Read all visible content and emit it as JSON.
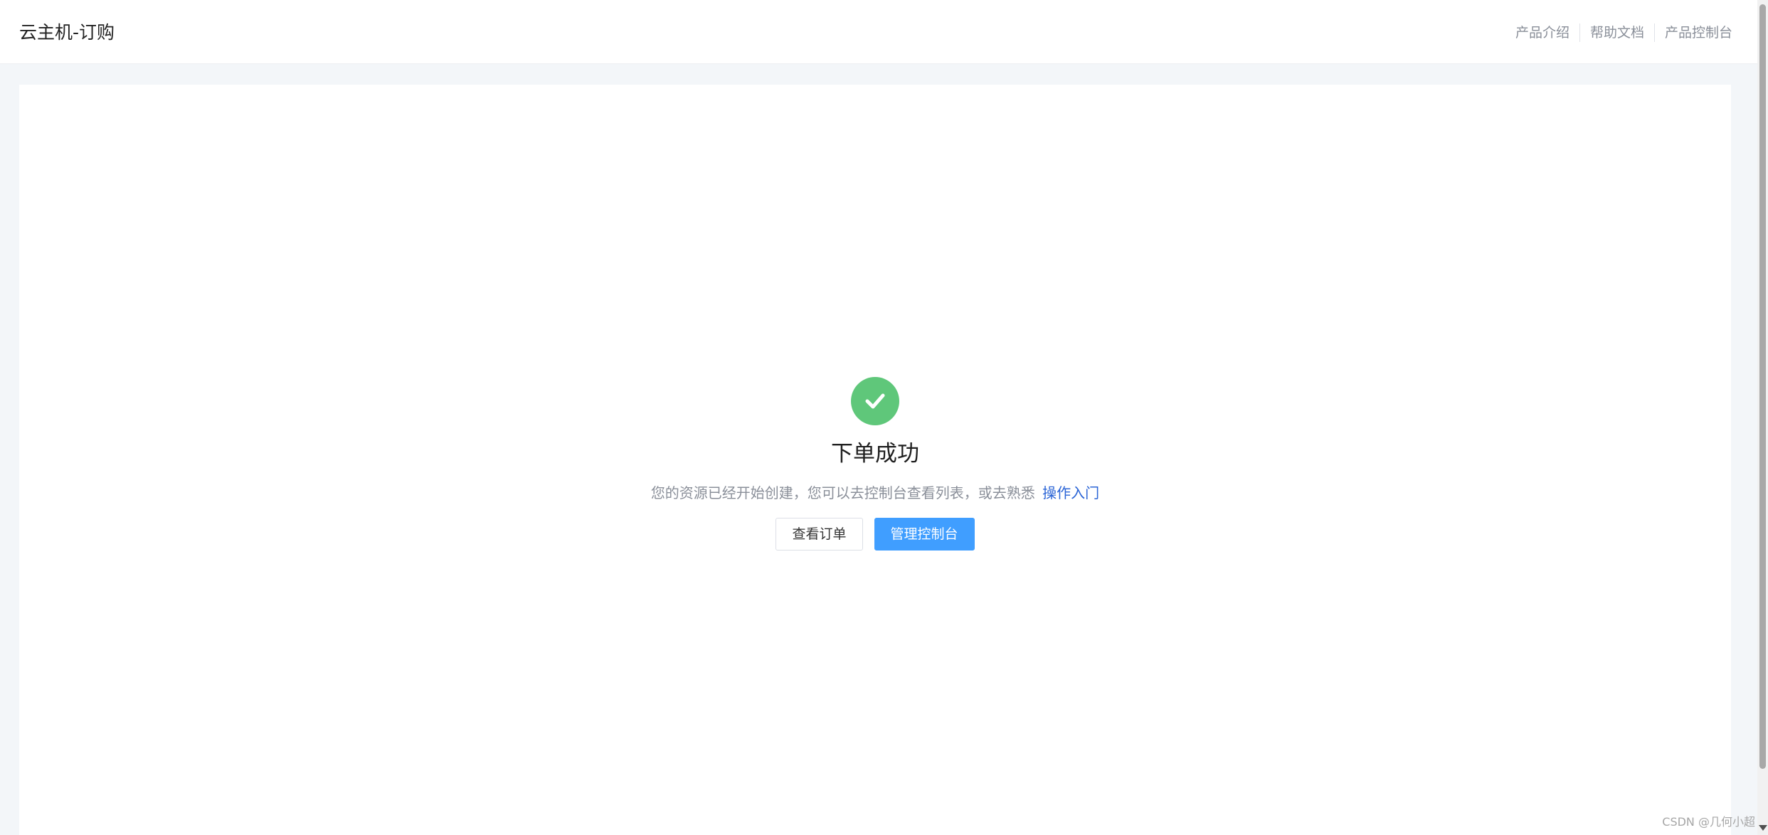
{
  "header": {
    "title": "云主机-订购",
    "nav": [
      {
        "label": "产品介绍"
      },
      {
        "label": "帮助文档"
      },
      {
        "label": "产品控制台"
      }
    ]
  },
  "result": {
    "icon": "check-circle-icon",
    "status_color": "#5fc77a",
    "title": "下单成功",
    "description": "您的资源已经开始创建，您可以去控制台查看列表，或去熟悉",
    "link_label": "操作入门",
    "buttons": {
      "view_order": "查看订单",
      "manage_console": "管理控制台"
    }
  },
  "colors": {
    "primary": "#409eff",
    "link": "#2a64d6",
    "page_bg": "#f3f6f9"
  },
  "watermark": "CSDN @几何小超"
}
